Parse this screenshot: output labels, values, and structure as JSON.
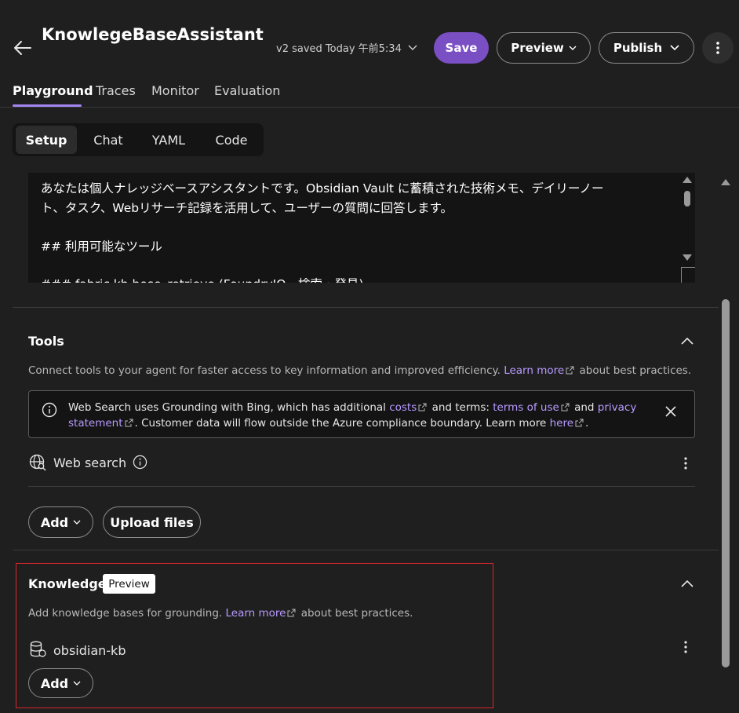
{
  "header": {
    "title": "KnowlegeBaseAssistant",
    "save_status": "v2 saved Today 午前5:34",
    "save_label": "Save",
    "preview_label": "Preview",
    "publish_label": "Publish"
  },
  "tabs": [
    {
      "label": "Playground",
      "active": true
    },
    {
      "label": "Traces"
    },
    {
      "label": "Monitor"
    },
    {
      "label": "Evaluation"
    }
  ],
  "segment": [
    {
      "label": "Setup",
      "active": true
    },
    {
      "label": "Chat"
    },
    {
      "label": "YAML"
    },
    {
      "label": "Code"
    }
  ],
  "instructions": {
    "lines": [
      "あなたは個人ナレッジベースアシスタントです。Obsidian Vault に蓄積された技術メモ、デイリーノー",
      "ト、タスク、Webリサーチ記録を活用して、ユーザーの質問に回答します。",
      "## 利用可能なツール",
      "### fabric kb bose_retrieve (FoundryIQ - 検索・発見)"
    ]
  },
  "tools": {
    "title": "Tools",
    "desc_prefix": "Connect tools to your agent for faster access to key information and improved efficiency.",
    "learn_more": "Learn more",
    "desc_suffix": "about best practices.",
    "notice": {
      "t1": "Web Search uses Grounding with Bing, which has additional",
      "costs": "costs",
      "t2": "and terms:",
      "terms": "terms of use",
      "t3": "and",
      "privacy": "privacy statement",
      "t4": ". Customer data will flow outside the Azure compliance boundary. Learn more",
      "here": "here",
      "t5": "."
    },
    "web_search_label": "Web search",
    "add_label": "Add",
    "upload_label": "Upload files"
  },
  "knowledge": {
    "title": "Knowledge",
    "badge": "Preview",
    "desc_prefix": "Add knowledge bases for grounding.",
    "learn_more": "Learn more",
    "desc_suffix": "about best practices.",
    "item_label": "obsidian-kb",
    "add_label": "Add"
  },
  "colors": {
    "accent": "#7b4fc4",
    "link": "#b89aff",
    "highlight_border": "#d9262b",
    "background": "#1f1f1f"
  }
}
